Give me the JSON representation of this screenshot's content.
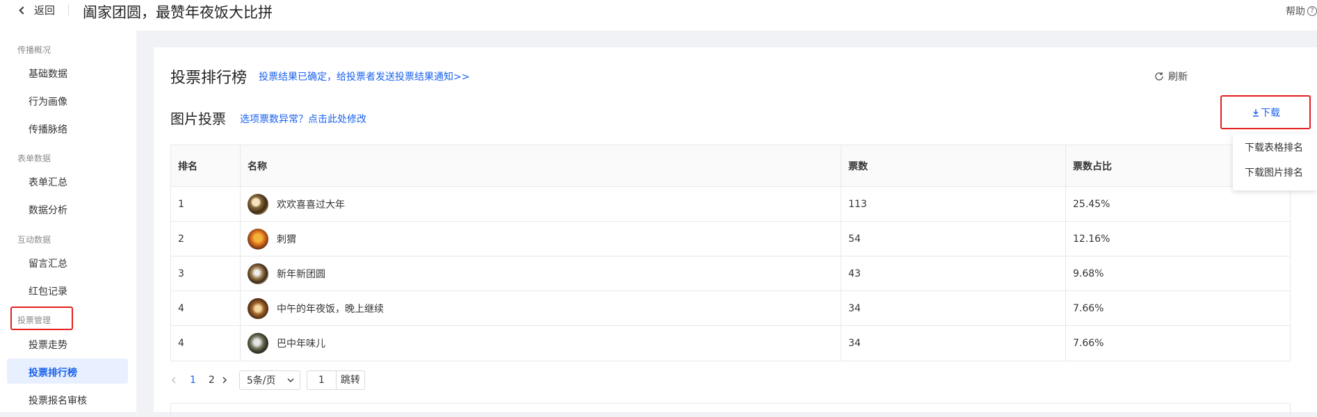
{
  "header": {
    "back_label": "返回",
    "title": "阖家团圆，最赞年夜饭大比拼",
    "help_label": "帮助"
  },
  "sidebar": {
    "sections": [
      {
        "title": "传播概况",
        "items": [
          "基础数据",
          "行为画像",
          "传播脉络"
        ]
      },
      {
        "title": "表单数据",
        "items": [
          "表单汇总",
          "数据分析"
        ]
      },
      {
        "title": "互动数据",
        "items": [
          "留言汇总",
          "红包记录"
        ]
      },
      {
        "title": "投票管理",
        "items": [
          "投票走势",
          "投票排行榜",
          "投票报名审核"
        ]
      }
    ],
    "active_item": "投票排行榜"
  },
  "main": {
    "heading": "投票排行榜",
    "notify_link": "投票结果已确定，给投票者发送投票结果通知>>",
    "refresh_label": "刷新",
    "subheading": "图片投票",
    "modify_link": "选项票数异常？点击此处修改",
    "download_label": "下载",
    "download_menu": [
      "下载表格排名",
      "下载图片排名"
    ],
    "table": {
      "columns": [
        "排名",
        "名称",
        "票数",
        "票数占比"
      ],
      "rows": [
        {
          "rank": "1",
          "name": "欢欢喜喜过大年",
          "votes": "113",
          "share": "25.45%"
        },
        {
          "rank": "2",
          "name": "刺猬",
          "votes": "54",
          "share": "12.16%"
        },
        {
          "rank": "3",
          "name": "新年新团圆",
          "votes": "43",
          "share": "9.68%"
        },
        {
          "rank": "4",
          "name": "中午的年夜饭，晚上继续",
          "votes": "34",
          "share": "7.66%"
        },
        {
          "rank": "4",
          "name": "巴中年味儿",
          "votes": "34",
          "share": "7.66%"
        }
      ]
    },
    "pagination": {
      "pages": [
        "1",
        "2"
      ],
      "current": "1",
      "page_size": "5条/页",
      "jump_value": "1",
      "jump_label": "跳转"
    }
  },
  "colors": {
    "accent": "#1a62ee",
    "highlight_box": "#e51e1e"
  }
}
